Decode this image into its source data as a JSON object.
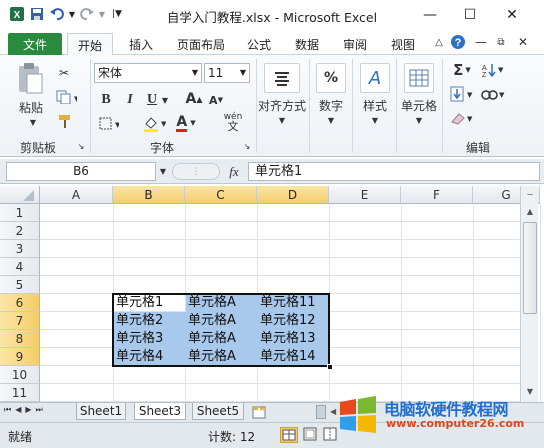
{
  "window": {
    "title": "自学入门教程.xlsx - Microsoft Excel"
  },
  "tabs": [
    {
      "label": "文件"
    },
    {
      "label": "开始"
    },
    {
      "label": "插入"
    },
    {
      "label": "页面布局"
    },
    {
      "label": "公式"
    },
    {
      "label": "数据"
    },
    {
      "label": "审阅"
    },
    {
      "label": "视图"
    }
  ],
  "ribbon": {
    "clipboard": {
      "paste": "粘贴",
      "group": "剪贴板"
    },
    "font": {
      "name": "宋体",
      "size": "11",
      "group": "字体",
      "bold": "B",
      "italic": "I",
      "underline": "U",
      "grow": "A",
      "shrink": "A",
      "fontcolor": "A",
      "phonetic": "wén"
    },
    "alignment": {
      "label": "对齐方式"
    },
    "number": {
      "label": "数字",
      "symbol": "%"
    },
    "styles": {
      "label": "样式",
      "symbol": "A"
    },
    "cells": {
      "label": "单元格"
    },
    "editing": {
      "group": "编辑",
      "sigma": "Σ"
    }
  },
  "formula_bar": {
    "name_box": "B6",
    "fx": "fx",
    "value": "单元格1"
  },
  "columns": [
    "A",
    "B",
    "C",
    "D",
    "E",
    "F",
    "G"
  ],
  "rows": [
    "1",
    "2",
    "3",
    "4",
    "5",
    "6",
    "7",
    "8",
    "9",
    "10",
    "11"
  ],
  "cells": [
    [
      "单元格1",
      "单元格A",
      "单元格11"
    ],
    [
      "单元格2",
      "单元格A",
      "单元格12"
    ],
    [
      "单元格3",
      "单元格A",
      "单元格13"
    ],
    [
      "单元格4",
      "单元格A",
      "单元格14"
    ]
  ],
  "sheets": [
    "Sheet1",
    "Sheet3",
    "Sheet5"
  ],
  "status": {
    "ready": "就绪",
    "count": "计数: 12"
  },
  "watermark": {
    "title": "电脑软硬件教程网",
    "url": "www.computer26.com"
  },
  "colors": {
    "file_tab": "#2a8a3e",
    "selection": "#a8c8ec",
    "header_selected": "#f3cd6a"
  }
}
